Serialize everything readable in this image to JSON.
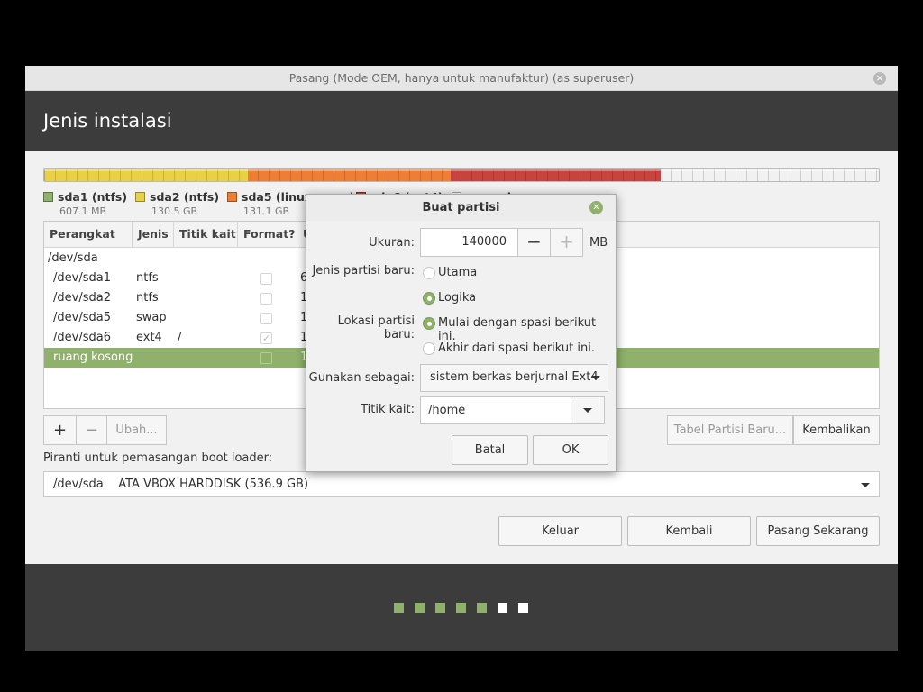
{
  "window": {
    "title": "Pasang (Mode OEM, hanya untuk manufaktur) (as superuser)",
    "close_glyph": "×"
  },
  "header": {
    "title": "Jenis instalasi"
  },
  "colors": {
    "accent": "#8fb16b",
    "header_bg": "#3c3c3c",
    "sda1": "#8fb16b",
    "sda2": "#e9d045",
    "sda5": "#ef7d32",
    "sda6": "#c8433d",
    "free": "#f1f1f1"
  },
  "partition_bar": {
    "segments": [
      {
        "name": "sda1",
        "fraction": 0.0011,
        "color": "#8fb16b"
      },
      {
        "name": "sda2",
        "fraction": 0.2427,
        "color": "#e9d045"
      },
      {
        "name": "sda5",
        "fraction": 0.2436,
        "color": "#ef7d32"
      },
      {
        "name": "sda6",
        "fraction": 0.2512,
        "color": "#c8433d"
      },
      {
        "name": "free",
        "fraction": 0.2614,
        "color": "#f1f1f1"
      }
    ]
  },
  "legend": [
    {
      "name": "sda1 (ntfs)",
      "size": "607.1 MB",
      "color": "#8fb16b"
    },
    {
      "name": "sda2 (ntfs)",
      "size": "130.5 GB",
      "color": "#e9d045"
    },
    {
      "name": "sda5 (linux-swap)",
      "size": "131.1 GB",
      "color": "#ef7d32"
    },
    {
      "name": "sda6 (ext4)",
      "size": "",
      "color": "#c8433d"
    },
    {
      "name": "ruang kosong",
      "size": "",
      "color": "#ffffff"
    }
  ],
  "table": {
    "headers": [
      "Perangkat",
      "Jenis",
      "Titik kait",
      "Format?",
      "U"
    ],
    "rows": [
      {
        "device": "/dev/sda",
        "type": "",
        "mount": "",
        "format": null,
        "used": ""
      },
      {
        "device": "/dev/sda1",
        "type": "ntfs",
        "mount": "",
        "format": false,
        "used": "6"
      },
      {
        "device": "/dev/sda2",
        "type": "ntfs",
        "mount": "",
        "format": false,
        "used": "1"
      },
      {
        "device": "/dev/sda5",
        "type": "swap",
        "mount": "",
        "format": false,
        "used": "1"
      },
      {
        "device": "/dev/sda6",
        "type": "ext4",
        "mount": "/",
        "format": true,
        "used": "1"
      },
      {
        "device": "ruang kosong",
        "type": "",
        "mount": "",
        "format": false,
        "used": "1",
        "selected": true
      }
    ]
  },
  "toolbar": {
    "add": "+",
    "remove": "−",
    "change": "Ubah...",
    "new_table": "Tabel Partisi Baru...",
    "revert": "Kembalikan"
  },
  "boot": {
    "label": "Piranti untuk pemasangan boot loader:",
    "value": "/dev/sda    ATA VBOX HARDDISK (536.9 GB)"
  },
  "nav": {
    "quit": "Keluar",
    "back": "Kembali",
    "install": "Pasang Sekarang"
  },
  "progress": {
    "total": 7,
    "done": 5
  },
  "dialog": {
    "title": "Buat partisi",
    "close_glyph": "✕",
    "size_label": "Ukuran:",
    "size_value": "140000",
    "minus": "−",
    "plus": "+",
    "unit": "MB",
    "type_label": "Jenis partisi baru:",
    "type_primary": "Utama",
    "type_logical": "Logika",
    "type_selected": "logical",
    "loc_label": "Lokasi partisi baru:",
    "loc_begin": "Mulai dengan spasi berikut ini.",
    "loc_end": "Akhir dari spasi berikut ini.",
    "loc_selected": "begin",
    "use_label": "Gunakan sebagai:",
    "use_value": "sistem berkas berjurnal Ext4",
    "mount_label": "Titik kait:",
    "mount_value": "/home",
    "cancel": "Batal",
    "ok": "OK"
  }
}
